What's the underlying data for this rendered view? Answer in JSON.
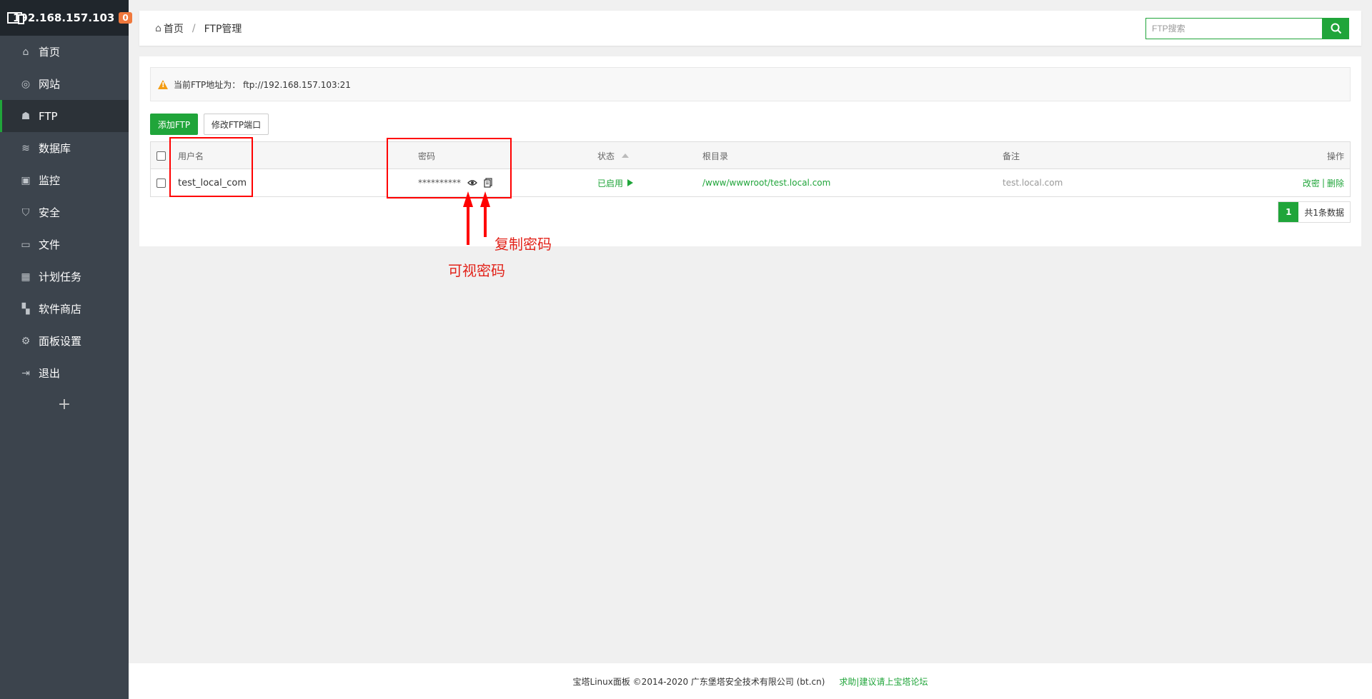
{
  "sidebar": {
    "ip": "192.168.157.103",
    "badge": "0",
    "items": [
      {
        "label": "首页",
        "icon": "home-icon"
      },
      {
        "label": "网站",
        "icon": "globe-icon"
      },
      {
        "label": "FTP",
        "icon": "ftp-icon"
      },
      {
        "label": "数据库",
        "icon": "database-icon"
      },
      {
        "label": "监控",
        "icon": "monitor-icon"
      },
      {
        "label": "安全",
        "icon": "shield-icon"
      },
      {
        "label": "文件",
        "icon": "folder-icon"
      },
      {
        "label": "计划任务",
        "icon": "calendar-icon"
      },
      {
        "label": "软件商店",
        "icon": "grid-icon"
      },
      {
        "label": "面板设置",
        "icon": "gear-icon"
      },
      {
        "label": "退出",
        "icon": "logout-icon"
      }
    ],
    "active_index": 2,
    "add_label": "+"
  },
  "breadcrumb": {
    "home": "首页",
    "sep": "/",
    "current": "FTP管理"
  },
  "search": {
    "placeholder": "FTP搜索"
  },
  "alert": {
    "text": "当前FTP地址为： ftp://192.168.157.103:21"
  },
  "buttons": {
    "add": "添加FTP",
    "port": "修改FTP端口"
  },
  "table": {
    "headers": {
      "username": "用户名",
      "password": "密码",
      "status": "状态",
      "root": "根目录",
      "note": "备注",
      "ops": "操作"
    },
    "rows": [
      {
        "username": "test_local_com",
        "password": "**********",
        "status": "已启用",
        "root": "/www/wwwroot/test.local.com",
        "note": "test.local.com",
        "edit": "改密",
        "sep": "|",
        "delete": "删除"
      }
    ]
  },
  "pager": {
    "current": "1",
    "total": "共1条数据"
  },
  "annotations": {
    "view_password": "可视密码",
    "copy_password": "复制密码"
  },
  "footer": {
    "copyright": "宝塔Linux面板 ©2014-2020 广东堡塔安全技术有限公司 (bt.cn)",
    "link": "求助|建议请上宝塔论坛"
  },
  "colors": {
    "accent": "#20a53a",
    "sidebar": "#3c444d",
    "annotation": "#e2231a"
  }
}
